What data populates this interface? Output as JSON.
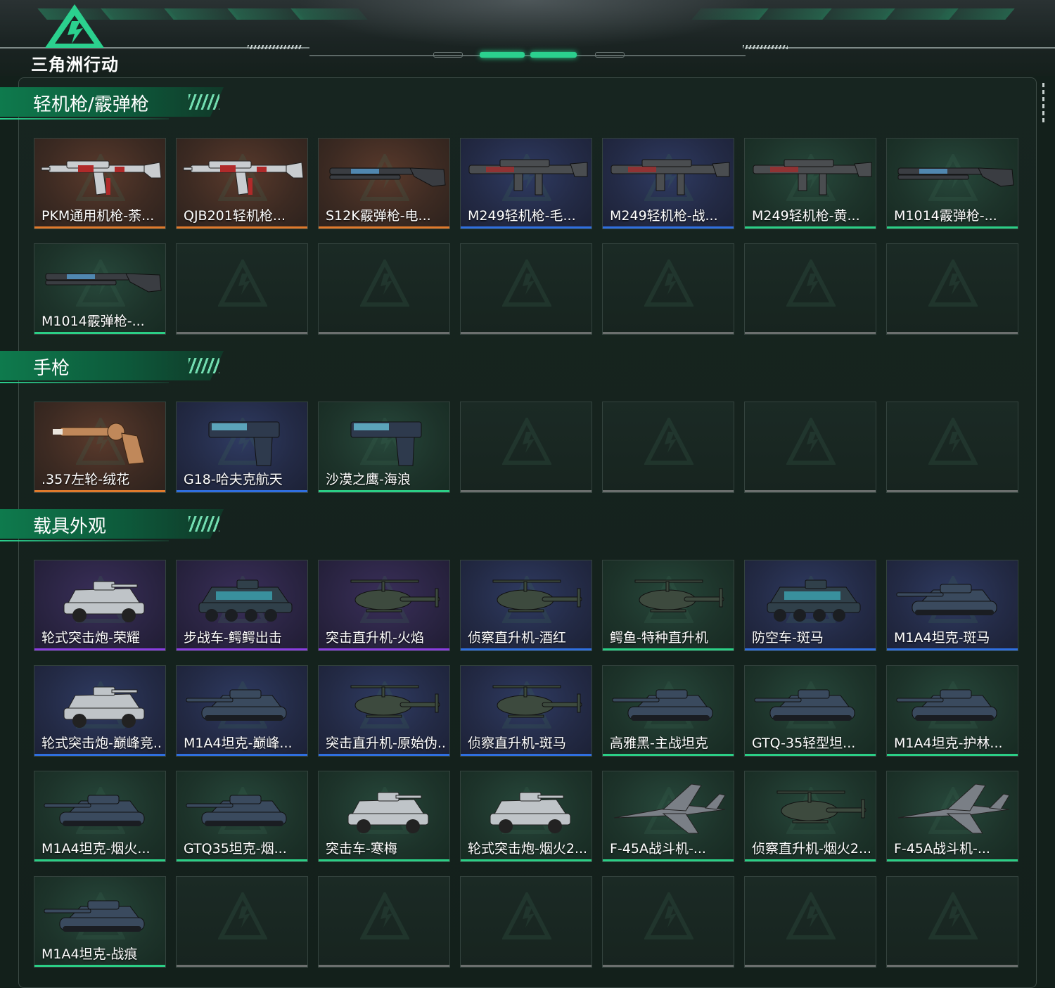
{
  "app": {
    "logo_text": "三角洲行动"
  },
  "colors": {
    "accent": "#2bd08e",
    "orange": "#e07a2c",
    "blue": "#2f6fe0",
    "green": "#2bcf86",
    "purple": "#8a3ee0",
    "empty": "#6b6f6e"
  },
  "sections": [
    {
      "title": "轻机枪/霰弹枪",
      "items": [
        {
          "name": "PKM通用机枪-荼...",
          "rarity": "orange",
          "icon": "rifle-icon"
        },
        {
          "name": "QJB201轻机枪...",
          "rarity": "orange",
          "icon": "rifle-icon"
        },
        {
          "name": "S12K霰弹枪-电...",
          "rarity": "orange",
          "icon": "shotgun-icon"
        },
        {
          "name": "M249轻机枪-毛...",
          "rarity": "blue",
          "icon": "machine-gun-icon"
        },
        {
          "name": "M249轻机枪-战...",
          "rarity": "blue",
          "icon": "machine-gun-icon"
        },
        {
          "name": "M249轻机枪-黄...",
          "rarity": "green",
          "icon": "machine-gun-icon"
        },
        {
          "name": "M1014霰弹枪-...",
          "rarity": "green",
          "icon": "shotgun-icon"
        },
        {
          "name": "M1014霰弹枪-...",
          "rarity": "green",
          "icon": "shotgun-icon"
        },
        {
          "name": "",
          "rarity": "empty"
        },
        {
          "name": "",
          "rarity": "empty"
        },
        {
          "name": "",
          "rarity": "empty"
        },
        {
          "name": "",
          "rarity": "empty"
        },
        {
          "name": "",
          "rarity": "empty"
        },
        {
          "name": "",
          "rarity": "empty"
        }
      ]
    },
    {
      "title": "手枪",
      "items": [
        {
          "name": ".357左轮-绒花",
          "rarity": "orange",
          "icon": "revolver-icon"
        },
        {
          "name": "G18-哈夫克航天",
          "rarity": "blue",
          "icon": "pistol-icon"
        },
        {
          "name": "沙漠之鹰-海浪",
          "rarity": "green",
          "icon": "pistol-icon"
        },
        {
          "name": "",
          "rarity": "empty"
        },
        {
          "name": "",
          "rarity": "empty"
        },
        {
          "name": "",
          "rarity": "empty"
        },
        {
          "name": "",
          "rarity": "empty"
        }
      ]
    },
    {
      "title": "载具外观",
      "items": [
        {
          "name": "轮式突击炮-荣耀",
          "rarity": "purple",
          "icon": "armored-car-icon"
        },
        {
          "name": "步战车-鳄鳄出击",
          "rarity": "purple",
          "icon": "ifv-icon"
        },
        {
          "name": "突击直升机-火焰",
          "rarity": "purple",
          "icon": "helicopter-icon"
        },
        {
          "name": "侦察直升机-酒红",
          "rarity": "blue",
          "icon": "helicopter-icon"
        },
        {
          "name": "鳄鱼-特种直升机",
          "rarity": "green",
          "icon": "helicopter-icon"
        },
        {
          "name": "防空车-斑马",
          "rarity": "blue",
          "icon": "ifv-icon"
        },
        {
          "name": "M1A4坦克-斑马",
          "rarity": "blue",
          "icon": "tank-icon"
        },
        {
          "name": "轮式突击炮-巅峰竞...",
          "rarity": "blue",
          "icon": "armored-car-icon"
        },
        {
          "name": "M1A4坦克-巅峰...",
          "rarity": "blue",
          "icon": "tank-icon"
        },
        {
          "name": "突击直升机-原始伪...",
          "rarity": "blue",
          "icon": "helicopter-icon"
        },
        {
          "name": "侦察直升机-斑马",
          "rarity": "blue",
          "icon": "helicopter-icon"
        },
        {
          "name": "高雅黑-主战坦克",
          "rarity": "green",
          "icon": "tank-icon"
        },
        {
          "name": "GTQ-35轻型坦...",
          "rarity": "green",
          "icon": "tank-icon"
        },
        {
          "name": "M1A4坦克-护林...",
          "rarity": "green",
          "icon": "tank-icon"
        },
        {
          "name": "M1A4坦克-烟火...",
          "rarity": "green",
          "icon": "tank-icon"
        },
        {
          "name": "GTQ35坦克-烟...",
          "rarity": "green",
          "icon": "tank-icon"
        },
        {
          "name": "突击车-寒梅",
          "rarity": "green",
          "icon": "armored-car-icon"
        },
        {
          "name": "轮式突击炮-烟火2...",
          "rarity": "green",
          "icon": "armored-car-icon"
        },
        {
          "name": "F-45A战斗机-...",
          "rarity": "green",
          "icon": "jet-icon"
        },
        {
          "name": "侦察直升机-烟火2...",
          "rarity": "green",
          "icon": "helicopter-icon"
        },
        {
          "name": "F-45A战斗机-...",
          "rarity": "green",
          "icon": "jet-icon"
        },
        {
          "name": "M1A4坦克-战痕",
          "rarity": "green",
          "icon": "tank-icon"
        },
        {
          "name": "",
          "rarity": "empty"
        },
        {
          "name": "",
          "rarity": "empty"
        },
        {
          "name": "",
          "rarity": "empty"
        },
        {
          "name": "",
          "rarity": "empty"
        },
        {
          "name": "",
          "rarity": "empty"
        },
        {
          "name": "",
          "rarity": "empty"
        }
      ]
    }
  ]
}
